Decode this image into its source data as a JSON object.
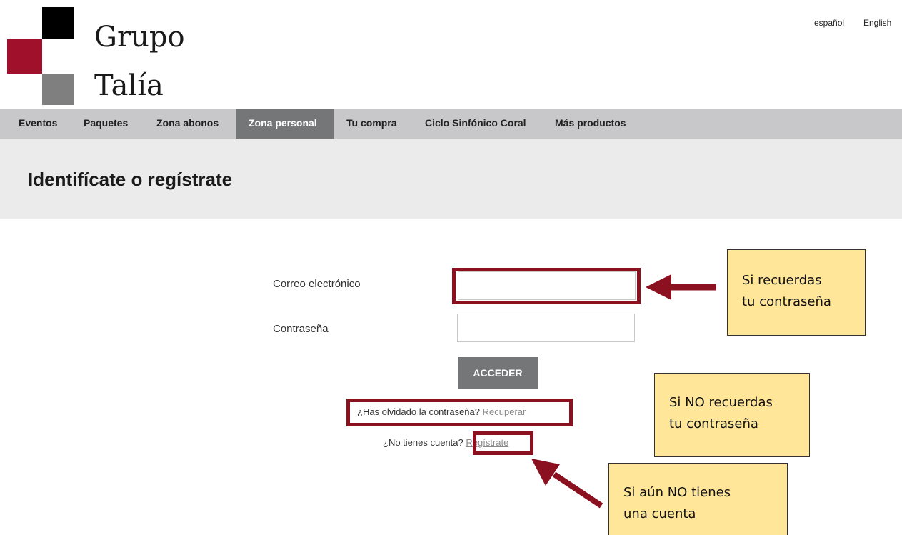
{
  "brand": {
    "line1": "Grupo",
    "line2": "Talía",
    "colors": {
      "black": "#000000",
      "red": "#a0102a",
      "gray": "#7f7f7f"
    }
  },
  "languages": [
    "español",
    "English"
  ],
  "nav": {
    "items": [
      "Eventos",
      "Paquetes",
      "Zona abonos",
      "Zona personal",
      "Tu compra",
      "Ciclo Sinfónico Coral",
      "Más productos"
    ],
    "active": "Zona personal"
  },
  "page": {
    "title": "Identifícate o regístrate"
  },
  "form": {
    "email_label": "Correo electrónico",
    "email_value": "",
    "password_label": "Contraseña",
    "password_value": "",
    "submit_label": "ACCEDER",
    "forgot_text": "¿Has olvidado la contraseña?",
    "forgot_link": "Recuperar",
    "register_text": "¿No tienes cuenta?",
    "register_link": "Regístrate"
  },
  "annotations": {
    "callout1": [
      "Si recuerdas",
      "tu contraseña"
    ],
    "callout2": [
      "Si NO recuerdas",
      "tu contraseña"
    ],
    "callout3": [
      "Si aún NO tienes",
      "una cuenta"
    ],
    "highlight_color": "#8b1121",
    "callout_color": "#ffe699"
  }
}
